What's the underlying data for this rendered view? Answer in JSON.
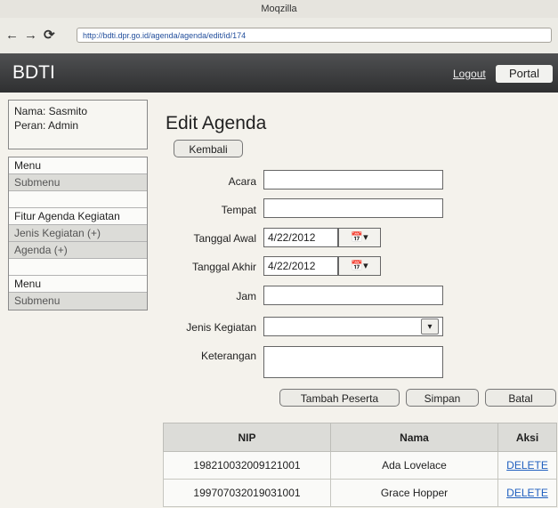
{
  "window": {
    "title": "Moqzilla"
  },
  "browser": {
    "url": "http://bdti.dpr.go.id/agenda/agenda/edit/id/174",
    "back_icon": "←",
    "forward_icon": "→",
    "reload_icon": "⟳"
  },
  "app": {
    "brand": "BDTI",
    "logout": "Logout",
    "portal": "Portal"
  },
  "user": {
    "nama": "Nama: Sasmito",
    "peran": "Peran: Admin"
  },
  "sidebar": {
    "items": [
      {
        "label": "Menu",
        "kind": "head"
      },
      {
        "label": "Submenu",
        "kind": "sub"
      },
      {
        "label": "",
        "kind": "blank"
      },
      {
        "label": "Fitur Agenda Kegiatan",
        "kind": "head"
      },
      {
        "label": "Jenis Kegiatan (+)",
        "kind": "sub"
      },
      {
        "label": "Agenda (+)",
        "kind": "sub"
      },
      {
        "label": "",
        "kind": "blank"
      },
      {
        "label": "Menu",
        "kind": "head"
      },
      {
        "label": "Submenu",
        "kind": "sub"
      }
    ]
  },
  "page": {
    "title": "Edit Agenda",
    "back_button": "Kembali"
  },
  "form": {
    "acara_label": "Acara",
    "acara_value": "",
    "tempat_label": "Tempat",
    "tempat_value": "",
    "tanggal_awal_label": "Tanggal Awal",
    "tanggal_awal_value": "4/22/2012",
    "tanggal_akhir_label": "Tanggal Akhir",
    "tanggal_akhir_value": "4/22/2012",
    "jam_label": "Jam",
    "jam_value": "",
    "jenis_label": "Jenis Kegiatan",
    "jenis_value": "",
    "keterangan_label": "Keterangan",
    "keterangan_value": "",
    "calendar_icon": "📅▾",
    "dropdown_icon": "▾"
  },
  "actions": {
    "tambah": "Tambah Peserta",
    "simpan": "Simpan",
    "batal": "Batal"
  },
  "table": {
    "headers": [
      "NIP",
      "Nama",
      "Aksi"
    ],
    "rows": [
      {
        "nip": "198210032009121001",
        "nama": "Ada Lovelace",
        "aksi": "DELETE"
      },
      {
        "nip": "199707032019031001",
        "nama": "Grace Hopper",
        "aksi": "DELETE"
      }
    ]
  }
}
